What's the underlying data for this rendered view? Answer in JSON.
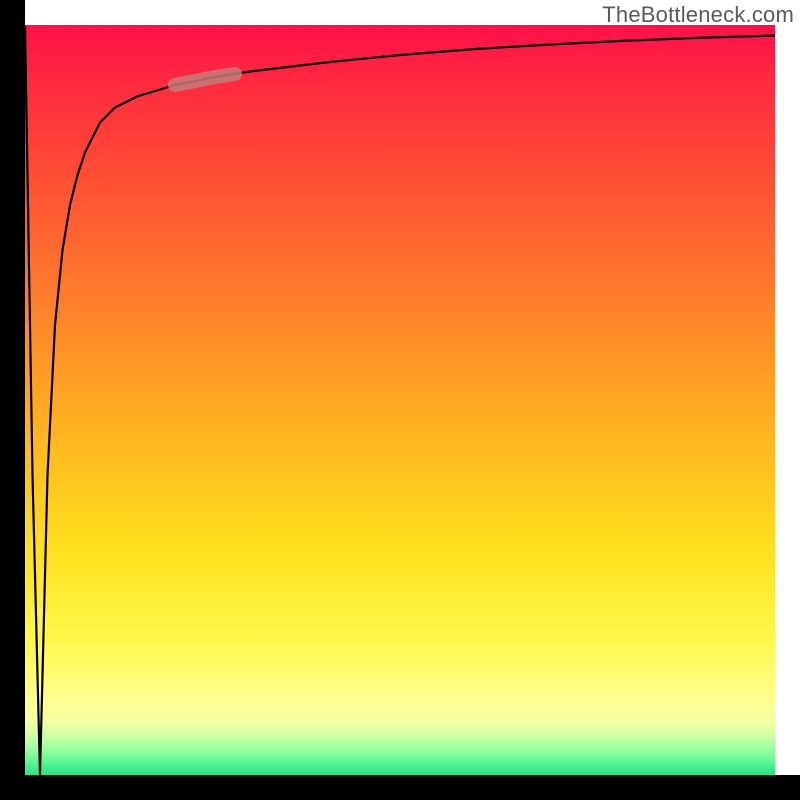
{
  "watermark": "TheBottleneck.com",
  "chart_data": {
    "type": "line",
    "title": "",
    "xlabel": "",
    "ylabel": "",
    "ylim": [
      0,
      100
    ],
    "xlim": [
      0,
      100
    ],
    "series": [
      {
        "name": "curve",
        "x": [
          0,
          1,
          2,
          3,
          4,
          5,
          6,
          7,
          8,
          9,
          10,
          12,
          15,
          20,
          25,
          30,
          40,
          50,
          60,
          70,
          80,
          90,
          100
        ],
        "values": [
          100,
          40,
          0,
          40,
          60,
          70,
          76,
          80,
          83,
          85,
          87,
          89,
          90.5,
          92,
          93,
          93.8,
          95,
          96,
          96.8,
          97.4,
          97.9,
          98.3,
          98.6
        ]
      }
    ],
    "highlight_segment": {
      "x_start": 20,
      "x_end": 28
    },
    "background_gradient": [
      "#ff0f4a",
      "#ff8e28",
      "#ffe01e",
      "#ffff90",
      "#2de084"
    ]
  }
}
